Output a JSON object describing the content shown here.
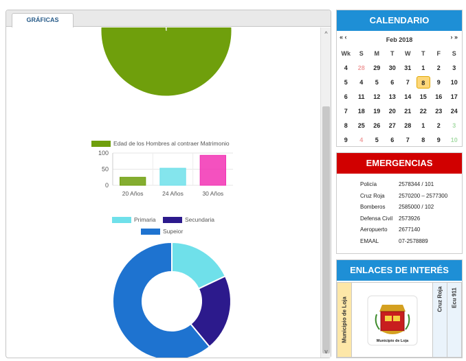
{
  "tabs": {
    "graficas": "GRÁFICAS"
  },
  "scroll": {
    "up": "^",
    "down": "v"
  },
  "chart_data": [
    {
      "type": "pie",
      "title": "",
      "slices": [
        {
          "label": "",
          "value": 99,
          "color": "#6f9f0c"
        },
        {
          "label": "",
          "value": 1,
          "color": "#ffffff"
        }
      ]
    },
    {
      "type": "bar",
      "categories": [
        "20 Años",
        "24 Años",
        "30 Años"
      ],
      "series": [
        {
          "name": "Edad de los Hombres al contraer Matrimonio",
          "values": [
            25,
            53,
            93
          ]
        }
      ],
      "colors": [
        "#6f9f0c",
        "#6fe0ea",
        "#f232b4"
      ],
      "yticks": [
        "100",
        "50",
        "0"
      ],
      "ylim": [
        0,
        100
      ],
      "grid": true
    },
    {
      "type": "pie",
      "donut": true,
      "legend": [
        {
          "name": "Primaria",
          "color": "#6fe0ea"
        },
        {
          "name": "Secundaria",
          "color": "#2c1a8c"
        },
        {
          "name": "Supeior",
          "color": "#1e73d0"
        }
      ],
      "values": [
        18,
        21,
        61
      ]
    }
  ],
  "calendar": {
    "title": "CALENDARIO",
    "nav_prev": "«  ‹",
    "nav_next": "›  »",
    "month": "Feb 2018",
    "headers": [
      "Wk",
      "S",
      "M",
      "T",
      "W",
      "T",
      "F",
      "S"
    ],
    "weeks": [
      [
        "4",
        "28",
        "29",
        "30",
        "31",
        "1",
        "2",
        "3"
      ],
      [
        "5",
        "4",
        "5",
        "6",
        "7",
        "8",
        "9",
        "10"
      ],
      [
        "6",
        "11",
        "12",
        "13",
        "14",
        "15",
        "16",
        "17"
      ],
      [
        "7",
        "18",
        "19",
        "20",
        "21",
        "22",
        "23",
        "24"
      ],
      [
        "8",
        "25",
        "26",
        "27",
        "28",
        "1",
        "2",
        "3"
      ],
      [
        "9",
        "4",
        "5",
        "6",
        "7",
        "8",
        "9",
        "10"
      ]
    ],
    "today": "8"
  },
  "emergencias": {
    "title": "EMERGENCIAS",
    "rows": [
      {
        "name": "Policía",
        "phone": "2578344 / 101"
      },
      {
        "name": "Cruz Roja",
        "phone": "2570200 – 2577300"
      },
      {
        "name": "Bomberos",
        "phone": "2585000 / 102"
      },
      {
        "name": "Defensa Civil",
        "phone": "2573926"
      },
      {
        "name": "Aeropuerto",
        "phone": "2677140"
      },
      {
        "name": "EMAAL",
        "phone": "07-2578889"
      }
    ]
  },
  "enlaces": {
    "title": "ENLACES DE INTERÉS",
    "items": [
      "Municipio de Loja",
      "Cruz Roja",
      "Ecu 911"
    ],
    "logo_caption": "Municipio de Loja"
  }
}
